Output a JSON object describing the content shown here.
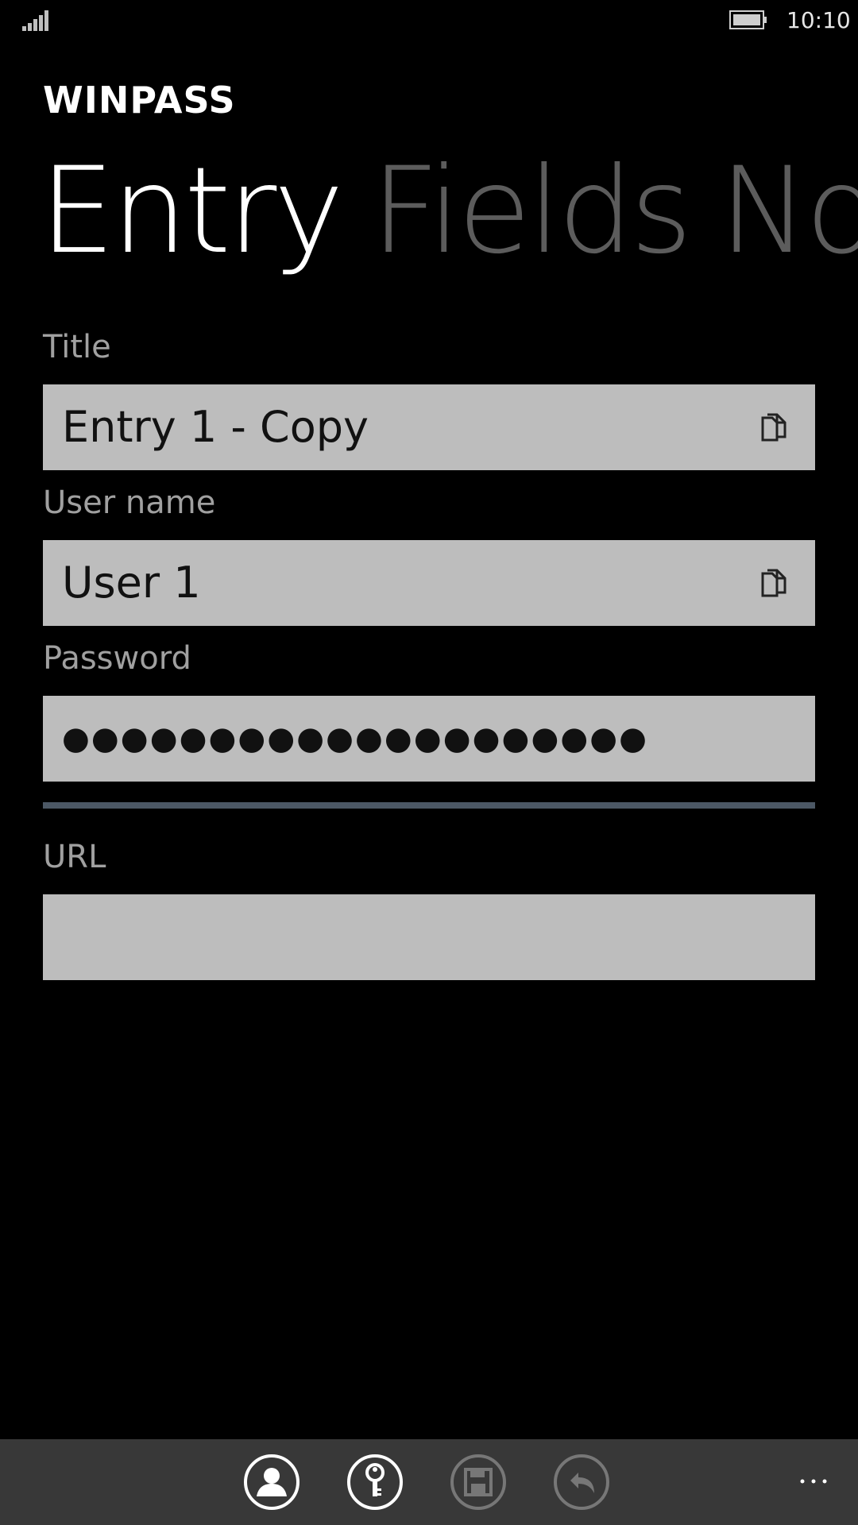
{
  "status_bar": {
    "time": "10:10",
    "signal_icon": "signal-strength-icon",
    "battery_icon": "battery-icon"
  },
  "app": {
    "title": "WINPASS"
  },
  "pivot": {
    "tabs": [
      {
        "label": "Entry",
        "active": true
      },
      {
        "label": "Fields",
        "active": false
      },
      {
        "label": "Notes",
        "active": false
      }
    ]
  },
  "form": {
    "title": {
      "label": "Title",
      "value": "Entry 1 - Copy"
    },
    "username": {
      "label": "User name",
      "value": "User 1"
    },
    "password": {
      "label": "Password",
      "value": "●●●●●●●●●●●●●●●●●●●●"
    },
    "url": {
      "label": "URL",
      "value": ""
    }
  },
  "app_bar": {
    "buttons": [
      {
        "name": "user-icon"
      },
      {
        "name": "key-icon"
      },
      {
        "name": "save-icon",
        "disabled": true
      },
      {
        "name": "undo-icon",
        "disabled": true
      }
    ],
    "more_icon": "ellipsis-icon"
  },
  "colors": {
    "background": "#000000",
    "field_background": "#bdbdbd",
    "label": "#a0a0a0",
    "inactive_pivot": "#5c5c5c",
    "strength_bar": "#4c5865",
    "app_bar": "#383838"
  }
}
